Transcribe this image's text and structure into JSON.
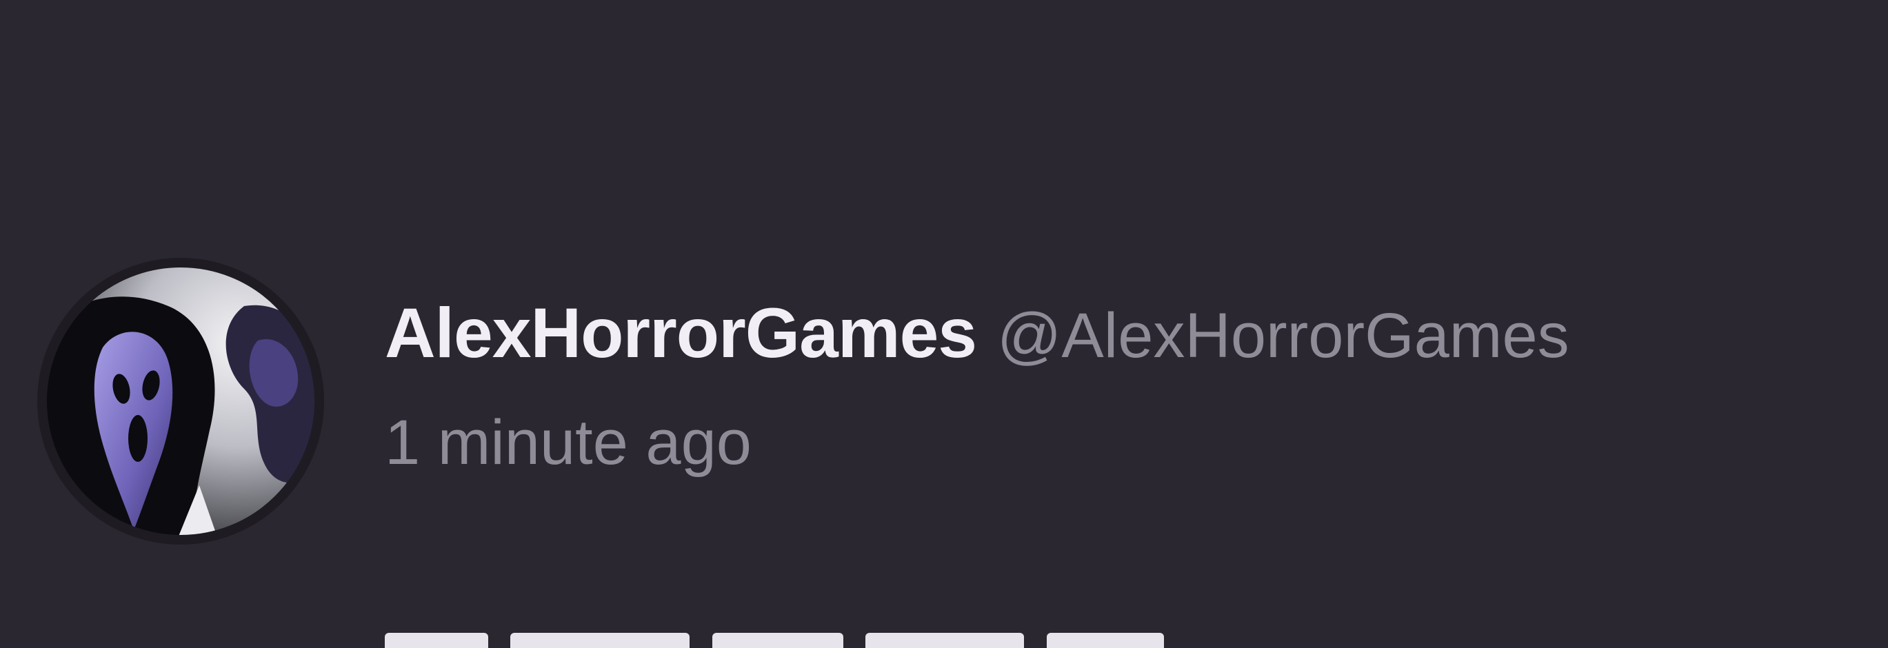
{
  "post": {
    "author": {
      "display_name": "AlexHorrorGames",
      "handle": "@AlexHorrorGames",
      "avatar_icon": "ghostface-mask-avatar"
    },
    "timestamp": "1 minute ago"
  },
  "colors": {
    "background": "#2a2731",
    "name": "#f1eff5",
    "muted": "#8f8b97",
    "avatar_accent": "#6e63b8"
  }
}
